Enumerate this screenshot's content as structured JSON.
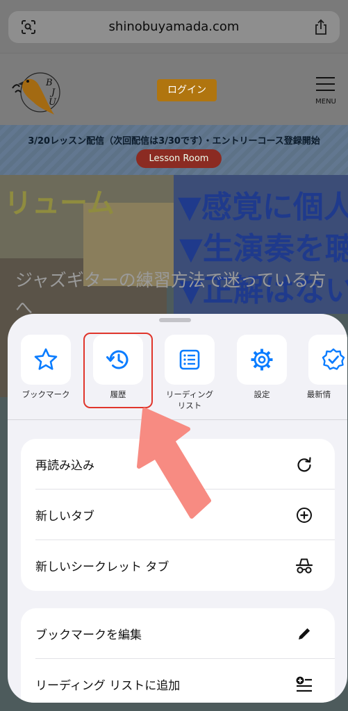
{
  "browser": {
    "url": "shinobuyamada.com"
  },
  "site": {
    "logo_letters": "BJU",
    "login_label": "ログイン",
    "menu_label": "MENU",
    "announcement": "3/20レッスン配信（次回配信は3/30です）・エントリーコース登録開始",
    "lesson_button": "Lesson Room",
    "hero_fragment_1": "リューム",
    "hero_fragment_2": "▼感覚に個人",
    "hero_fragment_3": "▼生演奏を聴",
    "hero_fragment_4": "▼正解はない",
    "hero_caption": "ジャズギターの練習方法で迷っている方へ"
  },
  "sheet": {
    "actions": [
      {
        "label": "ブックマーク",
        "icon": "star-icon"
      },
      {
        "label": "履歴",
        "icon": "history-icon"
      },
      {
        "label": "リーディング\nリスト",
        "icon": "reading-list-icon"
      },
      {
        "label": "設定",
        "icon": "gear-icon"
      },
      {
        "label": "最新情",
        "icon": "badge-check-icon"
      }
    ],
    "group1": [
      {
        "label": "再読み込み",
        "icon": "reload-icon"
      },
      {
        "label": "新しいタブ",
        "icon": "plus-circle-icon"
      },
      {
        "label": "新しいシークレット タブ",
        "icon": "incognito-icon"
      }
    ],
    "group2": [
      {
        "label": "ブックマークを編集",
        "icon": "pencil-icon"
      },
      {
        "label": "リーディング リストに追加",
        "icon": "add-reading-list-icon"
      }
    ]
  },
  "colors": {
    "accent_blue": "#0a7cff",
    "highlight_red": "#e0352b",
    "arrow_pink": "#f78b82",
    "login_orange": "#b0750f"
  }
}
